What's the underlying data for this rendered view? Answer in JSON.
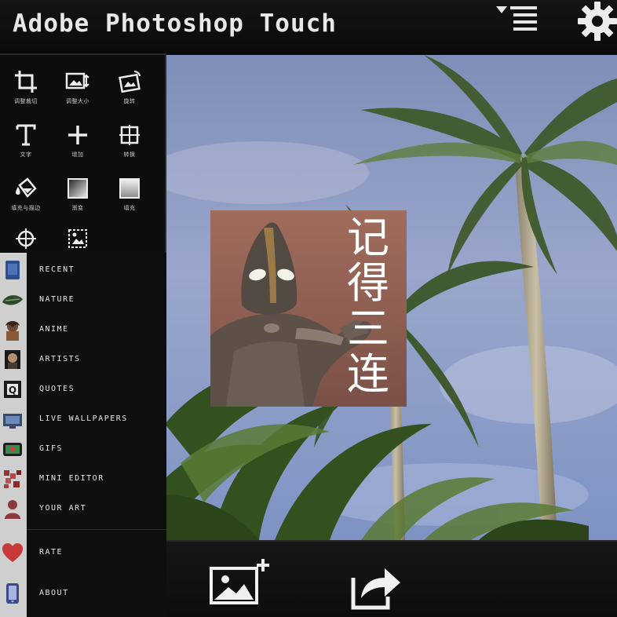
{
  "app": {
    "title": "Adobe Photoshop Touch"
  },
  "header": {
    "menu_icon": "menu-list-icon",
    "settings_icon": "gear-icon"
  },
  "tools": [
    {
      "icon": "crop-icon",
      "label": "调整裁切"
    },
    {
      "icon": "image-resize-icon",
      "label": "调整大小"
    },
    {
      "icon": "image-rotate-icon",
      "label": "旋转"
    },
    {
      "icon": "text-icon",
      "label": "文字"
    },
    {
      "icon": "plus-icon",
      "label": "增加"
    },
    {
      "icon": "transform-icon",
      "label": "转换"
    },
    {
      "icon": "paint-bucket-icon",
      "label": "填充与描边"
    },
    {
      "icon": "gradient-icon",
      "label": "渐变"
    },
    {
      "icon": "fill-square-icon",
      "label": "填充"
    },
    {
      "icon": "target-icon",
      "label": ""
    },
    {
      "icon": "selection-icon",
      "label": ""
    }
  ],
  "drawer": {
    "items": [
      {
        "label": "RECENT",
        "icon": "recent-icon"
      },
      {
        "label": "NATURE",
        "icon": "nature-icon"
      },
      {
        "label": "ANIME",
        "icon": "anime-icon"
      },
      {
        "label": "ARTISTS",
        "icon": "artists-icon"
      },
      {
        "label": "QUOTES",
        "icon": "quotes-icon"
      },
      {
        "label": "LIVE WALLPAPERS",
        "icon": "live-wallpapers-icon"
      },
      {
        "label": "GIFS",
        "icon": "gifs-icon"
      },
      {
        "label": "MINI EDITOR",
        "icon": "mini-editor-icon"
      },
      {
        "label": "YOUR ART",
        "icon": "your-art-icon"
      },
      {
        "label": "RATE",
        "icon": "heart-icon"
      },
      {
        "label": "ABOUT",
        "icon": "about-icon"
      }
    ]
  },
  "canvas": {
    "sticker_text": "记得三连"
  },
  "bottom_toolbar": {
    "add_image_icon": "add-image-icon",
    "share_icon": "share-icon"
  },
  "colors": {
    "background": "#0b0b0c",
    "sky": "#8d9cc4",
    "sticker_bg": "#a06c5c",
    "text": "#e8e8e8"
  }
}
